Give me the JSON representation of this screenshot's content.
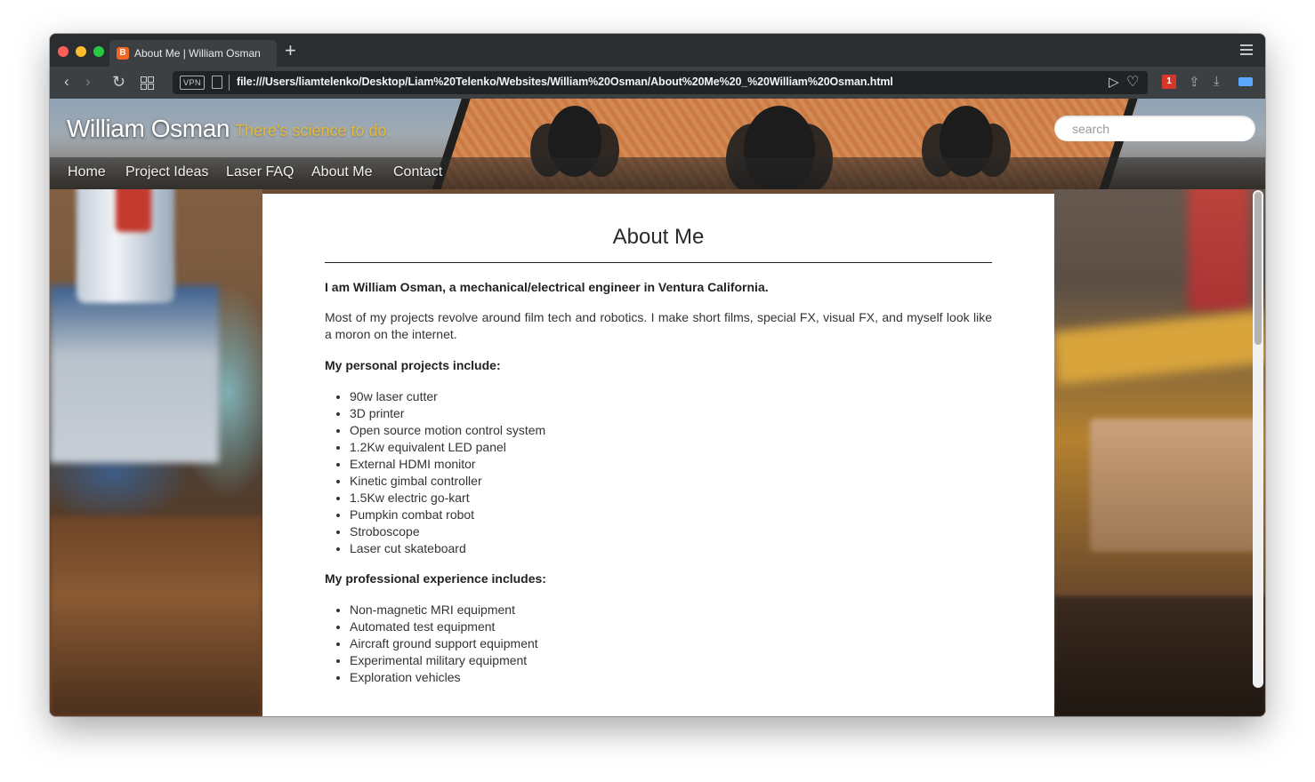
{
  "browser": {
    "tab_title": "About Me | William Osman",
    "tab_favicon_letter": "B",
    "new_tab_symbol": "+",
    "vpn_label": "VPN",
    "url": "file:///Users/liamtelenko/Desktop/Liam%20Telenko/Websites/William%20Osman/About%20Me%20_%20William%20Osman.html",
    "opera_ext_label": "1"
  },
  "site": {
    "title": "William Osman",
    "tagline": "There's science to do.",
    "search_placeholder": "search",
    "nav": [
      "Home",
      "Project Ideas",
      "Laser FAQ",
      "About Me",
      "Contact"
    ]
  },
  "page": {
    "heading": "About Me",
    "intro": "I am William Osman, a mechanical/electrical engineer in Ventura California.",
    "description": "Most of my projects revolve around film tech and robotics. I make short films, special FX, visual FX, and myself look like a moron on the internet.",
    "personal_heading": "My personal projects include:",
    "personal_projects": [
      "90w laser cutter",
      "3D printer",
      "Open source motion control system",
      "1.2Kw equivalent LED panel",
      "External HDMI monitor",
      "Kinetic gimbal controller",
      "1.5Kw electric go-kart",
      "Pumpkin combat robot",
      "Stroboscope",
      "Laser cut skateboard"
    ],
    "professional_heading": "My professional experience includes:",
    "professional_experience": [
      "Non-magnetic MRI equipment",
      "Automated test equipment",
      "Aircraft ground support equipment",
      "Experimental military equipment",
      "Exploration vehicles"
    ]
  },
  "colors": {
    "tagline": "#e2b93a",
    "window_chrome": "#2b2e31",
    "toolbar": "#3c4043"
  }
}
